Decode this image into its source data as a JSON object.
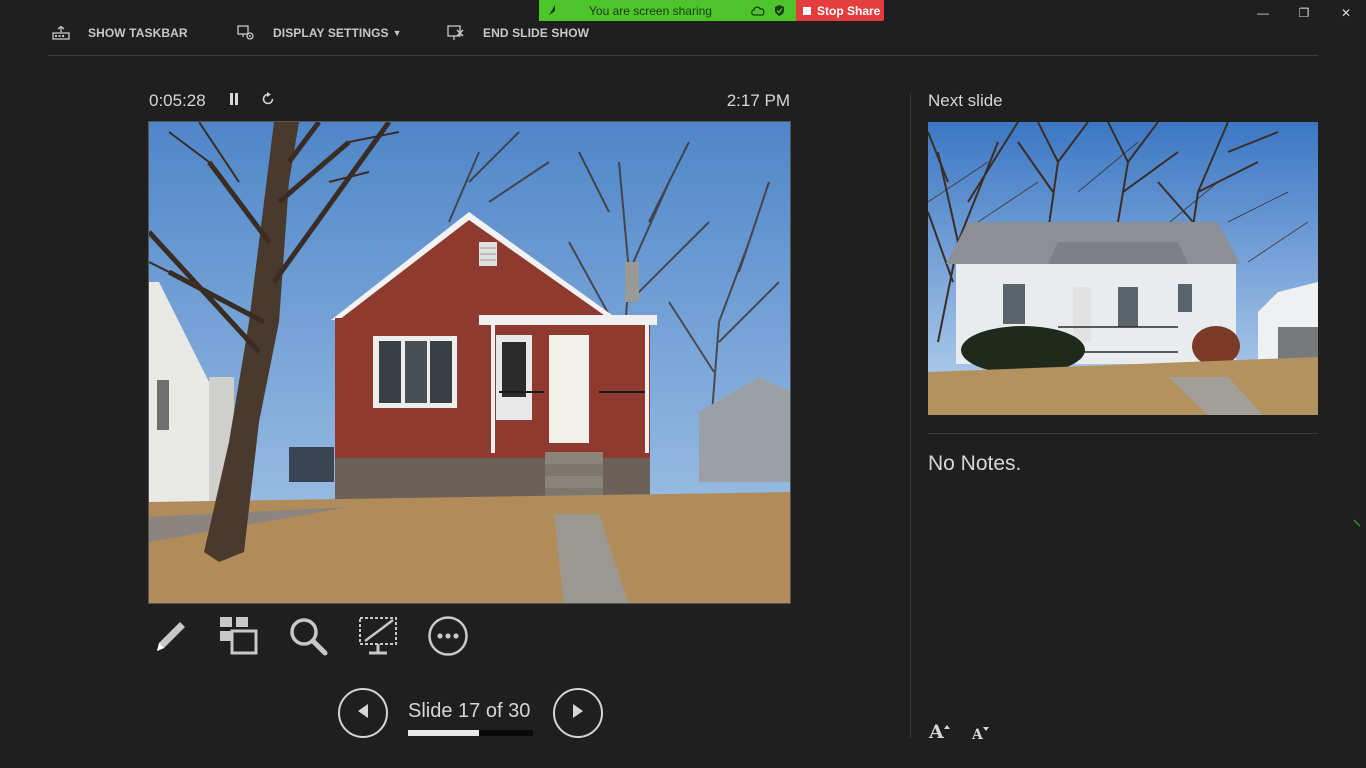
{
  "toolbar": {
    "show_taskbar": "SHOW TASKBAR",
    "display_settings": "DISPLAY SETTINGS",
    "display_settings_caret": "▼",
    "end_slide_show": "END SLIDE SHOW"
  },
  "share_bar": {
    "status_text": "You are screen sharing",
    "stop_label": "Stop Share",
    "green_color": "#4ec42b",
    "stop_color": "#e43d3d"
  },
  "window_controls": {
    "minimize": "—",
    "restore": "❐",
    "close": "✕"
  },
  "presenter": {
    "elapsed_time": "0:05:28",
    "clock": "2:17 PM",
    "current_slide": {
      "description_icon": "house-photo"
    },
    "tools": [
      "pen-tool-icon",
      "see-all-slides-icon",
      "zoom-icon",
      "black-screen-icon",
      "more-options-icon"
    ],
    "slide_counter": "Slide 17 of 30",
    "progress": 0.5667
  },
  "next_slide": {
    "label": "Next slide"
  },
  "notes": {
    "text": "No Notes.",
    "increase_font": "A",
    "decrease_font": "A"
  },
  "colors": {
    "background": "#1f1f1f",
    "text": "#d6d6d6"
  }
}
